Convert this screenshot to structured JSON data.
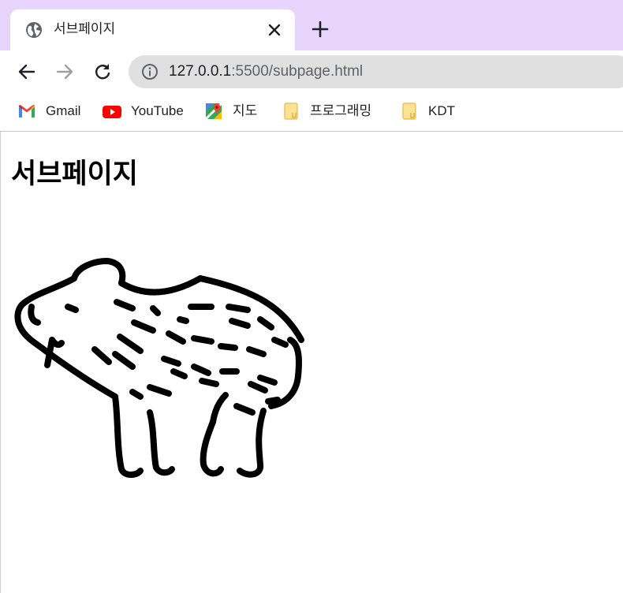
{
  "browser": {
    "tab": {
      "title": "서브페이지",
      "favicon": "globe-icon"
    },
    "address": {
      "host": "127.0.0.1",
      "path": ":5500/subpage.html"
    },
    "bookmarks": [
      {
        "label": "Gmail",
        "icon": "gmail-icon"
      },
      {
        "label": "YouTube",
        "icon": "youtube-icon"
      },
      {
        "label": "지도",
        "icon": "maps-icon"
      },
      {
        "label": "프로그래밍",
        "icon": "folder-icon"
      },
      {
        "label": "KDT",
        "icon": "folder-icon"
      }
    ],
    "colors": {
      "tabstrip": "#e8d5fe",
      "omnibox": "#e0e0e0",
      "folder": "#fde293"
    }
  },
  "page": {
    "heading": "서브페이지",
    "image": "capybara-line-drawing"
  }
}
